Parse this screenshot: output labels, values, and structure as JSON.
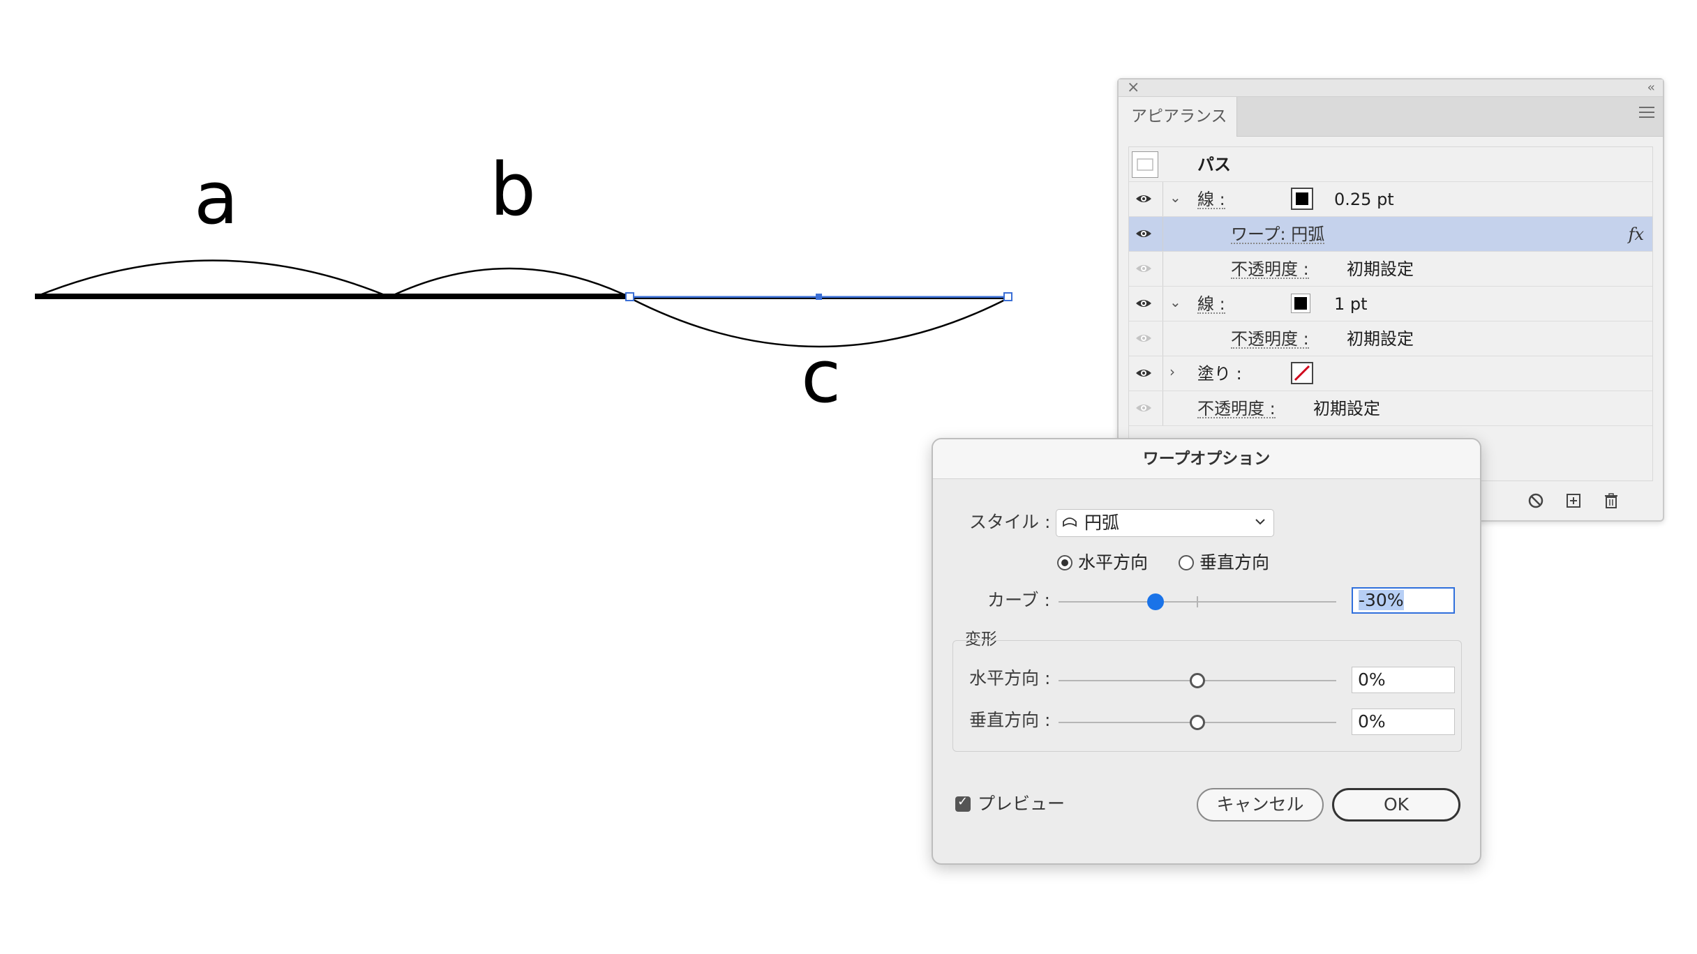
{
  "artboard": {
    "labels": [
      "a",
      "b",
      "c"
    ]
  },
  "appearance_panel": {
    "close_glyph": "×",
    "collapse_glyph": "‹‹",
    "tab_label": "アピアランス",
    "rows": [
      {
        "type": "header",
        "label": "パス"
      },
      {
        "type": "stroke",
        "label": "線 :",
        "value": "0.25 pt"
      },
      {
        "type": "effect",
        "label": "ワープ: 円弧",
        "fx": "fx"
      },
      {
        "type": "opacity",
        "label": "不透明度 :",
        "value": "初期設定"
      },
      {
        "type": "stroke",
        "label": "線 :",
        "value": "1 pt"
      },
      {
        "type": "opacity",
        "label": "不透明度 :",
        "value": "初期設定"
      },
      {
        "type": "fill",
        "label": "塗り :"
      },
      {
        "type": "opacity",
        "label": "不透明度 :",
        "value": "初期設定"
      }
    ],
    "footer_icons": [
      "clear-appearance-icon",
      "duplicate-item-icon",
      "delete-icon"
    ]
  },
  "warp_dialog": {
    "title": "ワープオプション",
    "style_label": "スタイル :",
    "style_value": "円弧",
    "orientation": {
      "horizontal_label": "水平方向",
      "vertical_label": "垂直方向",
      "selected": "horizontal"
    },
    "bend": {
      "label": "カーブ :",
      "value": "-30%",
      "level": -30
    },
    "distortion": {
      "group_label": "変形",
      "horizontal": {
        "label": "水平方向 :",
        "value": "0%",
        "level": 0
      },
      "vertical": {
        "label": "垂直方向 :",
        "value": "0%",
        "level": 0
      }
    },
    "preview_label": "プレビュー",
    "preview_checked": true,
    "cancel_label": "キャンセル",
    "ok_label": "OK"
  },
  "colors": {
    "accent": "#1a73e8",
    "selection_row": "#c5d2ec",
    "fill_none_slash": "#d0021b"
  }
}
